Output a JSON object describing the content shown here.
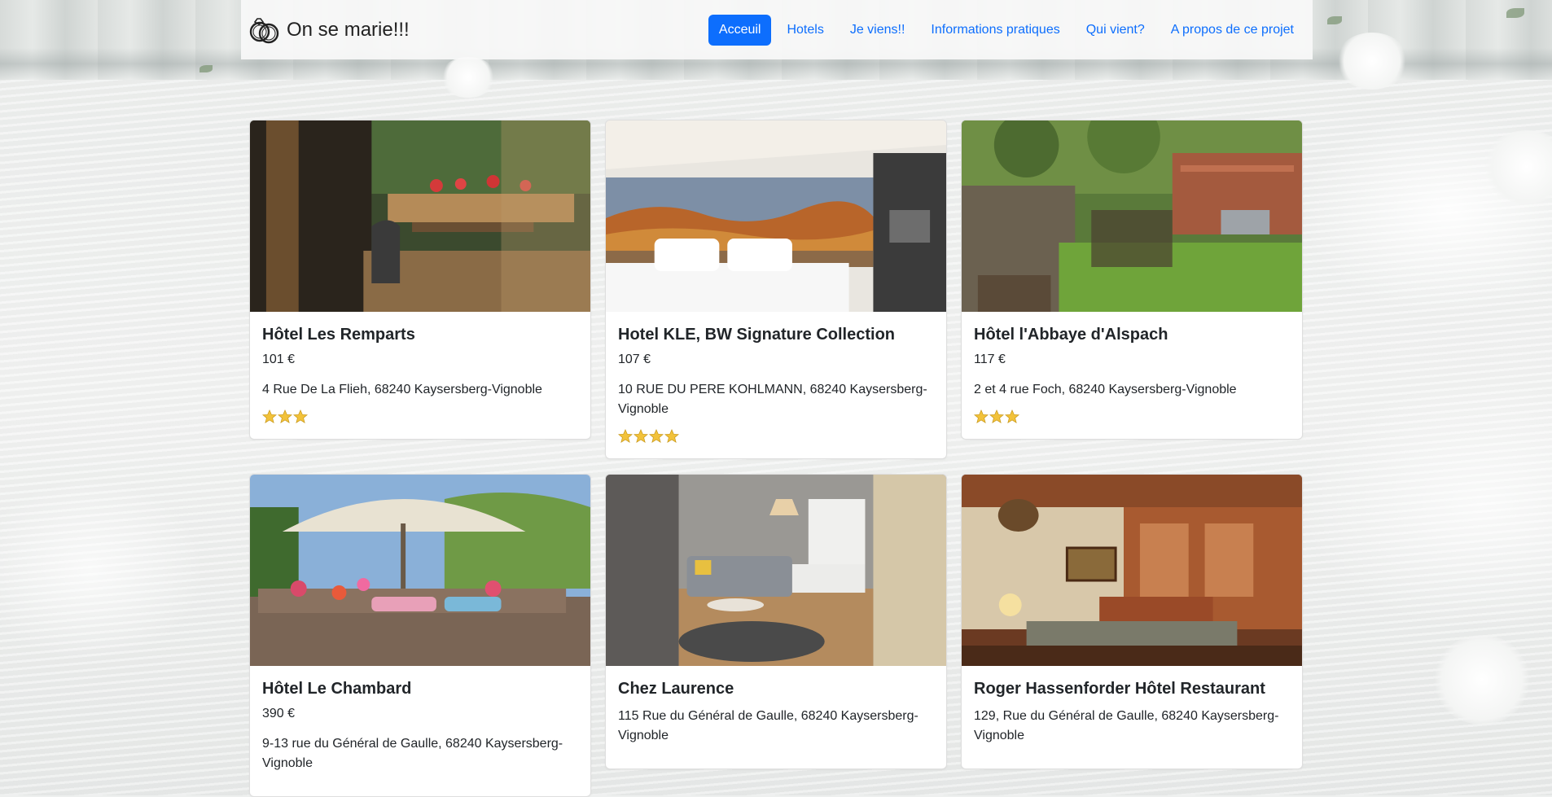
{
  "navbar": {
    "brand_icon": "wedding-rings-icon",
    "brand_name": "On se marie!!!",
    "links": [
      {
        "label": "Acceuil",
        "active": true
      },
      {
        "label": "Hotels",
        "active": false
      },
      {
        "label": "Je viens!!",
        "active": false
      },
      {
        "label": "Informations pratiques",
        "active": false
      },
      {
        "label": "Qui vient?",
        "active": false
      },
      {
        "label": "A propos de ce projet",
        "active": false
      }
    ]
  },
  "colors": {
    "accent": "#0d6efd",
    "star": "#f2c23a"
  },
  "hotels": [
    {
      "name": "Hôtel Les Remparts",
      "price": "101 €",
      "address": "4 Rue De La Flieh, 68240 Kaysersberg-Vignoble",
      "stars": 3,
      "photo": "balcony-terrace-photo"
    },
    {
      "name": "Hotel KLE, BW Signature Collection",
      "price": "107 €",
      "address": "10 RUE DU PERE KOHLMANN, 68240 Kaysersberg-Vignoble",
      "stars": 4,
      "photo": "hotel-bedroom-photo"
    },
    {
      "name": "Hôtel l'Abbaye d'Alspach",
      "price": "117 €",
      "address": "2 et 4 rue Foch, 68240 Kaysersberg-Vignoble",
      "stars": 3,
      "photo": "garden-courtyard-photo"
    },
    {
      "name": "Hôtel Le Chambard",
      "price": "390 €",
      "address": "9-13 rue du Général de Gaulle, 68240 Kaysersberg-Vignoble",
      "stars": 0,
      "photo": "parasol-terrace-photo"
    },
    {
      "name": "Chez Laurence",
      "price": "",
      "address": "115 Rue du Général de Gaulle, 68240 Kaysersberg-Vignoble",
      "stars": 0,
      "photo": "guest-room-photo"
    },
    {
      "name": "Roger Hassenforder Hôtel Restaurant",
      "price": "",
      "address": "129, Rue du Général de Gaulle, 68240 Kaysersberg-Vignoble",
      "stars": 0,
      "photo": "restaurant-interior-photo"
    }
  ]
}
